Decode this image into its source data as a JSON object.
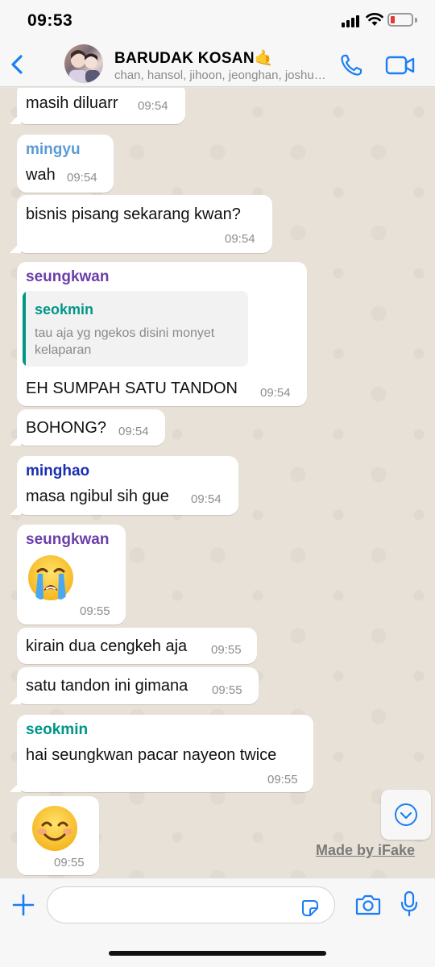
{
  "status_bar": {
    "time": "09:53",
    "battery_color": "#e53935"
  },
  "header": {
    "back_icon": "chevron-left-icon",
    "title": "BARUDAK KOSAN🤙",
    "subtitle": "chan, hansol, jihoon, jeonghan, joshua, seungcheol",
    "call_icon": "phone-icon",
    "video_icon": "video-camera-icon",
    "accent_color": "#1b7ef6"
  },
  "messages": [
    {
      "text": "masih diluarr",
      "time": "09:54"
    },
    {
      "sender": "mingyu",
      "sender_color": "#5b9bd5",
      "text": "wah",
      "time": "09:54"
    },
    {
      "text": "bisnis pisang sekarang kwan?",
      "time": "09:54"
    },
    {
      "sender": "seungkwan",
      "sender_color": "#6a3fa8",
      "quote": {
        "name": "seokmin",
        "text": "tau aja yg ngekos disini monyet kelaparan"
      },
      "text": "EH SUMPAH SATU TANDON",
      "time": "09:54"
    },
    {
      "text": "BOHONG?",
      "time": "09:54"
    },
    {
      "sender": "minghao",
      "sender_color": "#1a2fb0",
      "text": "masa ngibul sih gue",
      "time": "09:54"
    },
    {
      "sender": "seungkwan",
      "sender_color": "#6a3fa8",
      "emoji": "loudly-crying-face-emoji",
      "time": "09:55"
    },
    {
      "text": "kirain dua cengkeh aja",
      "time": "09:55"
    },
    {
      "text": "satu tandon ini gimana",
      "time": "09:55"
    },
    {
      "sender": "seokmin",
      "sender_color": "#009688",
      "text": "hai seungkwan pacar nayeon twice",
      "time": "09:55"
    },
    {
      "emoji": "smiling-face-emoji",
      "time": "09:55"
    }
  ],
  "watermark": "Made by iFake",
  "input": {
    "placeholder": ""
  }
}
